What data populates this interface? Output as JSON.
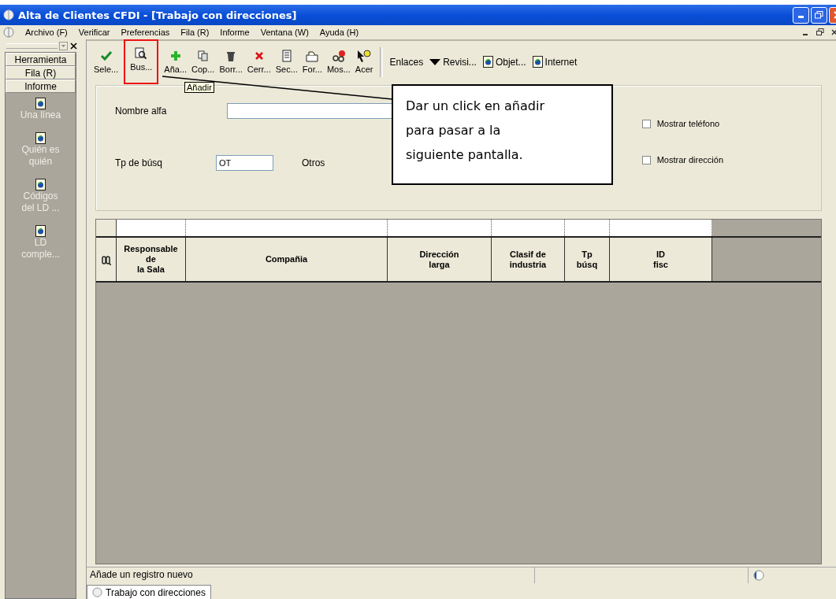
{
  "window": {
    "title": "Alta de Clientes CFDI - [Trabajo con direcciones]"
  },
  "menu": [
    "Archivo (F)",
    "Verificar",
    "Preferencias",
    "Fila (R)",
    "Informe",
    "Ventana (W)",
    "Ayuda (H)"
  ],
  "side_panel": {
    "buttons": [
      "Herramienta",
      "Fila (R)",
      "Informe"
    ],
    "items": [
      {
        "label": "Una línea"
      },
      {
        "label": "Quién es quién"
      },
      {
        "label": "Códigos del LD ..."
      },
      {
        "label": "LD comple..."
      }
    ]
  },
  "toolbar": [
    {
      "label": "Sele...",
      "kind": "check",
      "highlighted": false
    },
    {
      "label": "Bus...",
      "kind": "search",
      "highlighted": true
    },
    {
      "label": "Aña...",
      "kind": "plus",
      "highlighted": false
    },
    {
      "label": "Cop...",
      "kind": "copy",
      "highlighted": false
    },
    {
      "label": "Borr...",
      "kind": "trash",
      "highlighted": false
    },
    {
      "label": "Cerr...",
      "kind": "cross",
      "highlighted": false
    },
    {
      "label": "Sec...",
      "kind": "doc",
      "highlighted": false
    },
    {
      "label": "For...",
      "kind": "folder",
      "highlighted": false
    },
    {
      "label": "Mos...",
      "kind": "glasses",
      "highlighted": false
    },
    {
      "label": "Acer",
      "kind": "help",
      "highlighted": false
    }
  ],
  "links": [
    {
      "label": "Enlaces",
      "kind": "text"
    },
    {
      "label": "Revisi...",
      "kind": "caret"
    },
    {
      "label": "Objet...",
      "kind": "page"
    },
    {
      "label": "Internet",
      "kind": "page"
    }
  ],
  "tooltip": "Añadir",
  "callout": {
    "lines": [
      "Dar un click en añadir",
      "para pasar  a la",
      "siguiente pantalla."
    ]
  },
  "form": {
    "name_label": "Nombre alfa",
    "type_label": "Tp de búsq",
    "type_value": "OT",
    "type_desc": "Otros",
    "checkboxes": [
      {
        "label": "Mostrar teléfono",
        "checked": false
      },
      {
        "label": "Mostrar dirección",
        "checked": false
      }
    ]
  },
  "grid": {
    "columns": [
      {
        "lines": [
          "Responsable",
          "de",
          "la Sala"
        ]
      },
      {
        "lines": [
          "Compañia"
        ]
      },
      {
        "lines": [
          "Dirección",
          "larga"
        ]
      },
      {
        "lines": [
          "Clasif de",
          "industria"
        ]
      },
      {
        "lines": [
          "Tp",
          "búsq"
        ]
      },
      {
        "lines": [
          "ID",
          "fisc"
        ]
      }
    ]
  },
  "status_bar": {
    "message": "Añade un registro nuevo"
  },
  "bottom_tabs": [
    {
      "label": "Trabajo con direcciones",
      "selected": true
    }
  ]
}
